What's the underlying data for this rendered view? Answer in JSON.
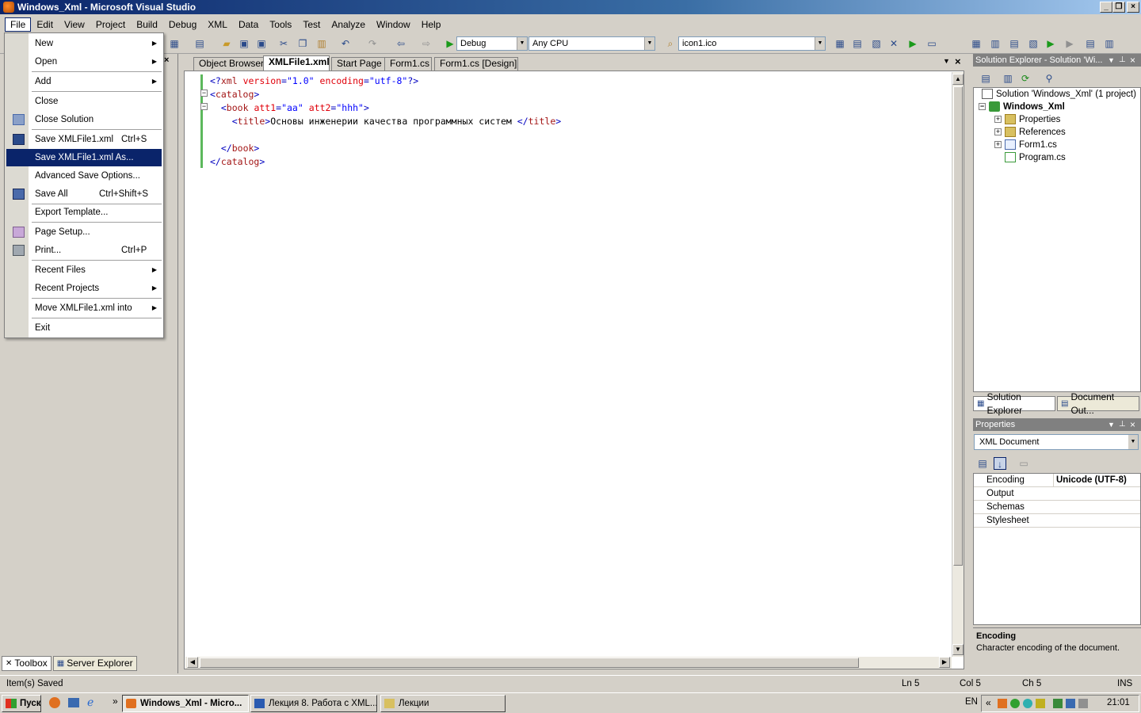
{
  "window": {
    "title": "Windows_Xml - Microsoft Visual Studio"
  },
  "menubar": {
    "items": [
      "File",
      "Edit",
      "View",
      "Project",
      "Build",
      "Debug",
      "XML",
      "Data",
      "Tools",
      "Test",
      "Analyze",
      "Window",
      "Help"
    ]
  },
  "toolbar": {
    "config": "Debug",
    "platform": "Any CPU",
    "find": "icon1.ico"
  },
  "file_menu": {
    "items": [
      {
        "label": "New",
        "shortcut": "",
        "submenu": true
      },
      {
        "label": "Open",
        "shortcut": "",
        "submenu": true
      },
      {
        "label": "Add",
        "shortcut": "",
        "submenu": true
      },
      {
        "label": "Close",
        "shortcut": ""
      },
      {
        "label": "Close Solution",
        "shortcut": ""
      },
      {
        "label": "Save XMLFile1.xml",
        "shortcut": "Ctrl+S"
      },
      {
        "label": "Save XMLFile1.xml As...",
        "shortcut": ""
      },
      {
        "label": "Advanced Save Options...",
        "shortcut": ""
      },
      {
        "label": "Save All",
        "shortcut": "Ctrl+Shift+S"
      },
      {
        "label": "Export Template...",
        "shortcut": ""
      },
      {
        "label": "Page Setup...",
        "shortcut": ""
      },
      {
        "label": "Print...",
        "shortcut": "Ctrl+P"
      },
      {
        "label": "Recent Files",
        "shortcut": "",
        "submenu": true
      },
      {
        "label": "Recent Projects",
        "shortcut": "",
        "submenu": true
      },
      {
        "label": "Move XMLFile1.xml into",
        "shortcut": "",
        "submenu": true
      },
      {
        "label": "Exit",
        "shortcut": ""
      }
    ],
    "submenu_arrow": "▶"
  },
  "doc_tabs": [
    "Object Browser",
    "XMLFile1.xml",
    "Start Page",
    "Form1.cs",
    "Form1.cs [Design]"
  ],
  "editor": {
    "line1": {
      "open": "<?",
      "name": "xml",
      "a1": "version",
      "eq": "=",
      "v1": "\"1.0\"",
      "a2": "encoding",
      "v2": "\"utf-8\"",
      "close": "?>"
    },
    "line2": {
      "open": "<",
      "name": "catalog",
      "close": ">"
    },
    "line3": {
      "open": "<",
      "name": "book",
      "a1": "att1",
      "eq": "=",
      "v1": "\"aa\"",
      "a2": "att2",
      "v2": "\"hhh\"",
      "close": ">"
    },
    "line4": {
      "open": "<",
      "name": "title",
      "close": ">",
      "text": "Основы инженерии качества программных систем ",
      "end_open": "</",
      "end_close": ">"
    },
    "line6": {
      "open": "</",
      "name": "book",
      "close": ">"
    },
    "line7": {
      "open": "</",
      "name": "catalog",
      "close": ">"
    }
  },
  "solution_explorer": {
    "header": "Solution Explorer - Solution 'Wi...",
    "solution": "Solution 'Windows_Xml' (1 project)",
    "project": "Windows_Xml",
    "items": [
      "Properties",
      "References",
      "Form1.cs",
      "Program.cs"
    ],
    "tabs": [
      "Solution Explorer",
      "Document Out..."
    ]
  },
  "left_tabs": [
    "Toolbox",
    "Server Explorer"
  ],
  "properties": {
    "header": "Properties",
    "object": "XML Document",
    "rows": [
      {
        "name": "Encoding",
        "value": "Unicode (UTF-8)"
      },
      {
        "name": "Output",
        "value": ""
      },
      {
        "name": "Schemas",
        "value": ""
      },
      {
        "name": "Stylesheet",
        "value": ""
      }
    ],
    "desc_title": "Encoding",
    "desc_text": "Character encoding of the document."
  },
  "status": {
    "message": "Item(s) Saved",
    "ln": "Ln 5",
    "col": "Col 5",
    "ch": "Ch 5",
    "mode": "INS"
  },
  "taskbar": {
    "start": "Пуск",
    "chevron": "»",
    "tasks": [
      "Windows_Xml - Micro...",
      "Лекция 8. Работа с XML...",
      "Лекции"
    ],
    "lang": "EN",
    "tray_chevron": "«",
    "clock": "21:01"
  },
  "colors": {
    "title_bar": "#0a246a",
    "menu_highlight": "#0a246a",
    "xml_tag": "#a31515",
    "xml_attr": "#e0000a",
    "xml_value": "#0000ff",
    "xml_bracket": "#0000c0",
    "change_bar": "#5cb85c"
  }
}
